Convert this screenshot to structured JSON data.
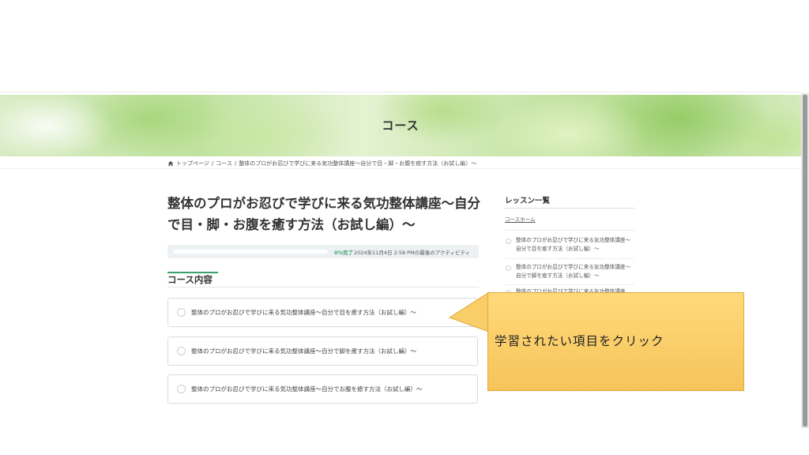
{
  "hero": {
    "title": "コース"
  },
  "breadcrumb": {
    "home": "トップページ",
    "separator": "/",
    "course": "コース",
    "current": "整体のプロがお忍びで学びに来る気功整体講座〜自分で目・脚・お腹を癒す方法（お試し編）〜"
  },
  "course": {
    "title": "整体のプロがお忍びで学びに来る気功整体講座〜自分で目・脚・お腹を癒す方法（お試し編）〜",
    "progress": {
      "percent": 0,
      "label": "0%完了",
      "activity": "2024年11月4日 2:58 PMの最後のアクティビティ"
    },
    "content_heading": "コース内容",
    "lessons": [
      "整体のプロがお忍びで学びに来る気功整体講座〜自分で目を癒す方法（お試し編）〜",
      "整体のプロがお忍びで学びに来る気功整体講座〜自分で脚を癒す方法（お試し編）〜",
      "整体のプロがお忍びで学びに来る気功整体講座〜自分でお腹を癒す方法（お試し編）〜"
    ]
  },
  "sidebar": {
    "heading": "レッスン一覧",
    "home_link": "コースホーム",
    "items": [
      "整体のプロがお忍びで学びに来る気功整体講座〜自分で目を癒す方法（お試し編）〜",
      "整体のプロがお忍びで学びに来る気功整体講座〜自分で脚を癒す方法（お試し編）〜",
      "整体のプロがお忍びで学びに来る気功整体講座"
    ]
  },
  "callout": {
    "text": "学習されたい項目をクリック"
  },
  "colors": {
    "accent": "#3aa36b",
    "callout": "#f6c45a"
  }
}
